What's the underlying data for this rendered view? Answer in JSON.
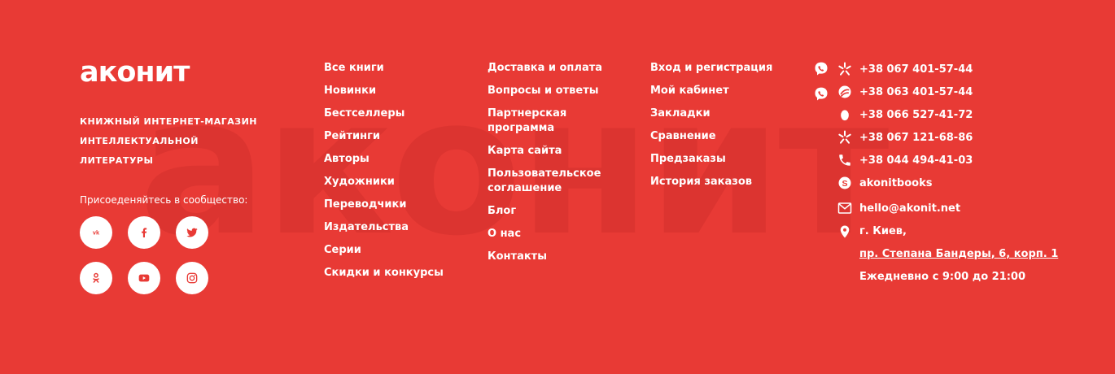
{
  "brand": {
    "logo_text": "акoнит",
    "watermark_text": "акoнит",
    "tagline": "Книжный интернет-магазин интеллектуальной литературы"
  },
  "community": {
    "label": "Присоеденяйтесь в сообщество:",
    "networks": [
      {
        "name": "vk",
        "label": "VK"
      },
      {
        "name": "facebook",
        "label": "f"
      },
      {
        "name": "twitter",
        "label": "twitter"
      },
      {
        "name": "odnoklassniki",
        "label": "ok"
      },
      {
        "name": "youtube",
        "label": "youtube"
      },
      {
        "name": "instagram",
        "label": "instagram"
      }
    ]
  },
  "nav": {
    "catalog": [
      "Все книги",
      "Новинки",
      "Бестселлеры",
      "Рейтинги",
      "Авторы",
      "Художники",
      "Переводчики",
      "Издательства",
      "Серии",
      "Скидки и конкурсы"
    ],
    "info": [
      "Доставка и оплата",
      "Вопросы и ответы",
      "Партнерская программа",
      "Карта сайта",
      "Пользовательское соглашение",
      "Блог",
      "О нас",
      "Контакты"
    ],
    "account": [
      "Вход и регистрация",
      "Мой кабинет",
      "Закладки",
      "Сравнение",
      "Предзаказы",
      "История заказов"
    ]
  },
  "contacts": {
    "phone1": "+38 067 401-57-44",
    "phone2": "+38 063 401-57-44",
    "phone3": "+38 066 527-41-72",
    "phone4": "+38 067 121-68-86",
    "phone5": "+38 044 494-41-03",
    "skype": "akonitbooks",
    "email": "hello@akonit.net",
    "city": "г. Киев,",
    "address": "пр. Степана Бандеры, 6, корп. 1",
    "hours": "Ежедневно с 9:00 до 21:00"
  },
  "colors": {
    "background": "#e83a35",
    "text": "#ffffff",
    "watermark": "#d8332f"
  }
}
